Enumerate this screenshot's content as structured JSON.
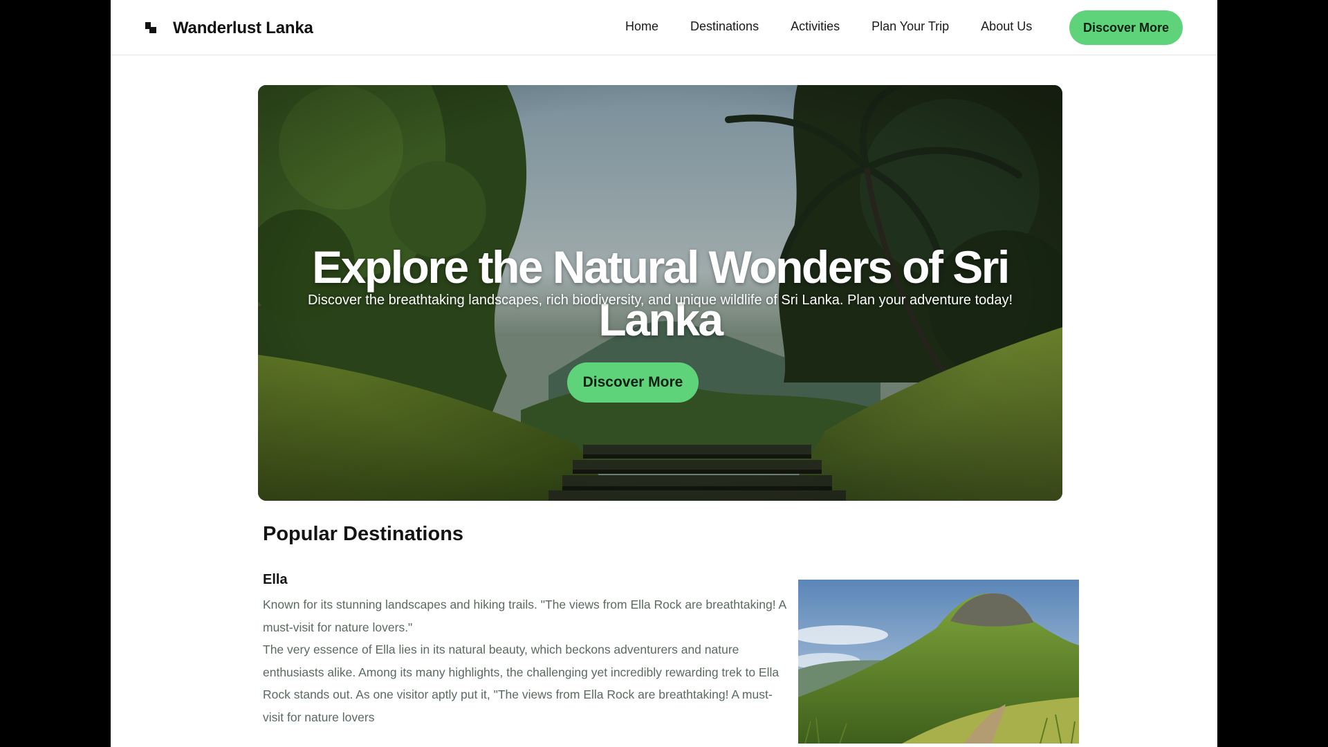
{
  "nav": {
    "brand": "Wanderlust Lanka",
    "links": [
      "Home",
      "Destinations",
      "Activities",
      "Plan Your Trip",
      "About Us"
    ],
    "cta": "Discover More"
  },
  "hero": {
    "title": "Explore the Natural Wonders of Sri Lanka",
    "subtitle": "Discover the breathtaking landscapes, rich biodiversity, and unique wildlife of Sri Lanka. Plan your adventure today!",
    "cta": "Discover More"
  },
  "popular": {
    "title": "Popular Destinations",
    "items": [
      {
        "name": "Ella",
        "paragraphs": [
          "Known for its stunning landscapes and hiking trails. \"The views from Ella Rock are breathtaking! A must-visit for nature lovers.\"",
          "The very essence of Ella lies in its natural beauty, which beckons adventurers and nature enthusiasts alike. Among its many highlights, the challenging yet incredibly rewarding trek to Ella Rock stands out. As one visitor aptly put it, \"The views from Ella Rock are breathtaking! A must-visit for nature lovers"
        ]
      }
    ]
  },
  "colors": {
    "accent": "#5fd37a",
    "text_muted": "#5b6a60"
  },
  "icons": {
    "logo": "logo-icon"
  }
}
